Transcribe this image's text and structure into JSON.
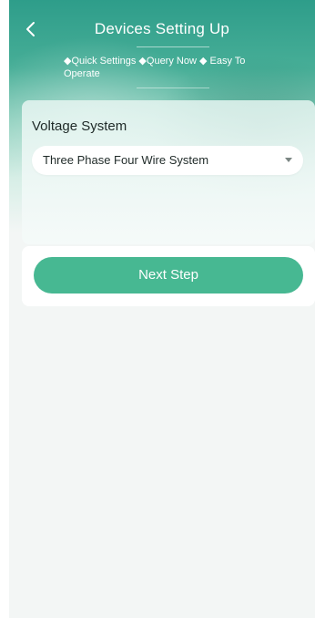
{
  "header": {
    "title": "Devices Setting Up",
    "subtitle": "◆Quick Settings ◆Query Now ◆ Easy To Operate",
    "back_icon": "chevron-left-icon"
  },
  "form": {
    "voltage_label": "Voltage System",
    "voltage_value": "Three Phase Four Wire System"
  },
  "actions": {
    "next_label": "Next Step"
  },
  "colors": {
    "accent": "#47b892",
    "header": "#2e9d8a"
  }
}
